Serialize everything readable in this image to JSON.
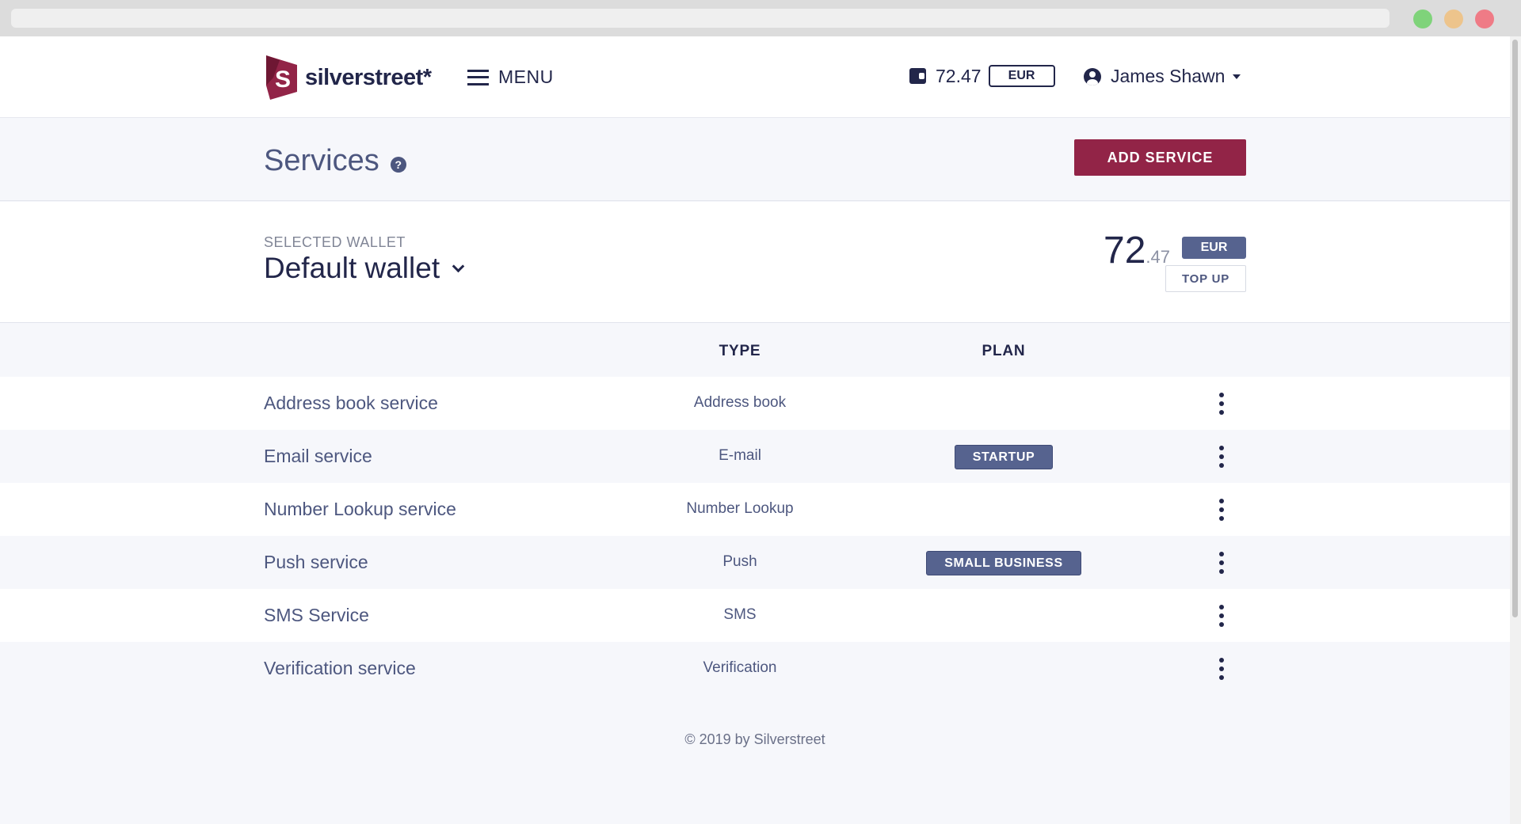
{
  "header": {
    "brand": "silverstreet*",
    "menu_label": "MENU",
    "balance": "72.47",
    "currency": "EUR",
    "user_name": "James Shawn"
  },
  "page": {
    "title": "Services",
    "help": "?",
    "add_service_label": "ADD SERVICE"
  },
  "wallet": {
    "label": "SELECTED WALLET",
    "name": "Default wallet",
    "balance_int": "72",
    "balance_dec": ".47",
    "currency": "EUR",
    "top_up_label": "TOP UP"
  },
  "table": {
    "columns": [
      "",
      "TYPE",
      "PLAN"
    ],
    "rows": [
      {
        "name": "Address book service",
        "type": "Address book",
        "plan": ""
      },
      {
        "name": "Email service",
        "type": "E-mail",
        "plan": "STARTUP"
      },
      {
        "name": "Number Lookup service",
        "type": "Number Lookup",
        "plan": ""
      },
      {
        "name": "Push service",
        "type": "Push",
        "plan": "SMALL BUSINESS"
      },
      {
        "name": "SMS Service",
        "type": "SMS",
        "plan": ""
      },
      {
        "name": "Verification service",
        "type": "Verification",
        "plan": ""
      }
    ]
  },
  "footer": {
    "copyright": "© 2019 by Silverstreet"
  },
  "colors": {
    "brand": "#922447",
    "navy": "#22264a",
    "badge": "#56638f"
  }
}
